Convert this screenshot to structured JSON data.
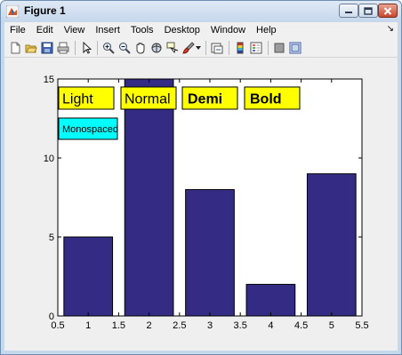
{
  "window": {
    "title": "Figure 1",
    "controls": [
      "minimize",
      "maximize",
      "close"
    ]
  },
  "menu": {
    "items": [
      "File",
      "Edit",
      "View",
      "Insert",
      "Tools",
      "Desktop",
      "Window",
      "Help"
    ]
  },
  "toolbar": {
    "icons": [
      "new-figure-icon",
      "open-file-icon",
      "save-icon",
      "print-icon",
      "edit-plot-arrow-icon",
      "zoom-in-icon",
      "zoom-out-icon",
      "pan-hand-icon",
      "rotate-3d-icon",
      "data-cursor-icon",
      "brush-icon",
      "brush-dropdown-icon",
      "link-plot-icon",
      "insert-colorbar-icon",
      "insert-legend-icon",
      "hide-plot-tools-icon",
      "show-plot-tools-icon"
    ]
  },
  "colors": {
    "bar": "#342c84",
    "label_box": "#ffff00",
    "mono_box": "#00ffff"
  },
  "annotations": [
    {
      "text": "Light",
      "weight": "light",
      "fill": "#ffff00"
    },
    {
      "text": "Normal",
      "weight": "normal",
      "fill": "#ffff00"
    },
    {
      "text": "Demi",
      "weight": "demi",
      "fill": "#ffff00"
    },
    {
      "text": "Bold",
      "weight": "bold",
      "fill": "#ffff00"
    },
    {
      "text": "Monospaced",
      "weight": "normal",
      "fill": "#00ffff"
    }
  ],
  "chart_data": {
    "type": "bar",
    "x": [
      1,
      2,
      3,
      4,
      5
    ],
    "values": [
      5,
      15,
      8,
      2,
      9
    ],
    "xlim": [
      0.5,
      5.5
    ],
    "ylim": [
      0,
      15
    ],
    "xticks": [
      "0.5",
      "1",
      "1.5",
      "2",
      "2.5",
      "3",
      "3.5",
      "4",
      "4.5",
      "5",
      "5.5"
    ],
    "yticks": [
      "0",
      "5",
      "10",
      "15"
    ],
    "grid": false,
    "bar_color": "#342c84"
  }
}
